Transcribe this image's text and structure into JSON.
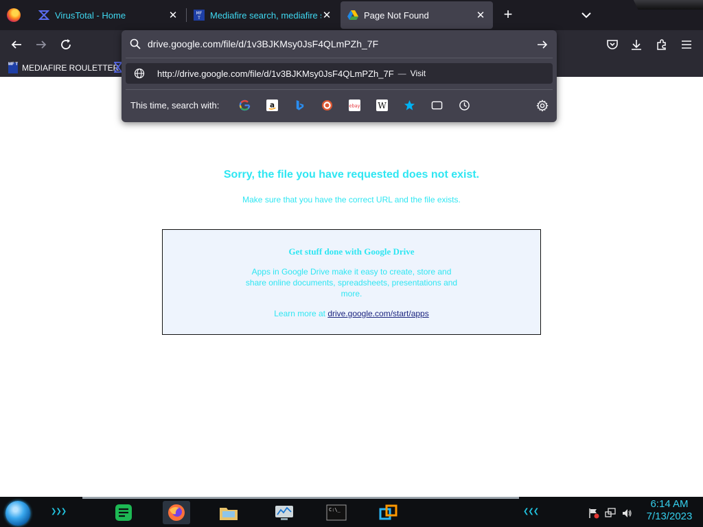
{
  "browser": {
    "tabs": [
      {
        "title": "VirusTotal - Home",
        "close": "✕"
      },
      {
        "title": "Mediafire search, mediafire sea",
        "close": "✕"
      },
      {
        "title": "Page Not Found",
        "close": "✕"
      }
    ],
    "new_tab": "+",
    "url_bar": {
      "value": "drive.google.com/file/d/1v3BJKMsy0JsF4QLmPZh_7F",
      "suggestion_url": "http://drive.google.com/file/d/1v3BJKMsy0JsF4QLmPZh_7F",
      "suggestion_dash": "—",
      "suggestion_action": "Visit",
      "search_with_label": "This time, search with:",
      "engines": [
        "google-icon",
        "amazon-icon",
        "bing-icon",
        "duckduckgo-icon",
        "ebay-icon",
        "wikipedia-icon",
        "bookmarks-icon",
        "tabs-icon",
        "history-icon"
      ]
    },
    "bookmarks": [
      {
        "label": "MEDIAFIRE ROULETTER",
        "icon_text": "MF T"
      }
    ]
  },
  "page": {
    "error_title": "Sorry, the file you have requested does not exist.",
    "error_subtitle": "Make sure that you have the correct URL and the file exists.",
    "drive_box": {
      "heading": "Get stuff done with Google Drive",
      "body": "Apps in Google Drive make it easy to create, store and share online documents, spreadsheets, presentations and more.",
      "learn_more_prefix": "Learn more at",
      "learn_more_link": "drive.google.com/start/apps"
    }
  },
  "taskbar": {
    "time": "6:14 AM",
    "date": "7/13/2023",
    "chevrons": "❯❯❯",
    "chevrons_right": "❮❮❮"
  },
  "colors": {
    "page_text": "#2ee6f2",
    "chrome_bg": "#2b2a33",
    "tab_active": "#42414d"
  }
}
